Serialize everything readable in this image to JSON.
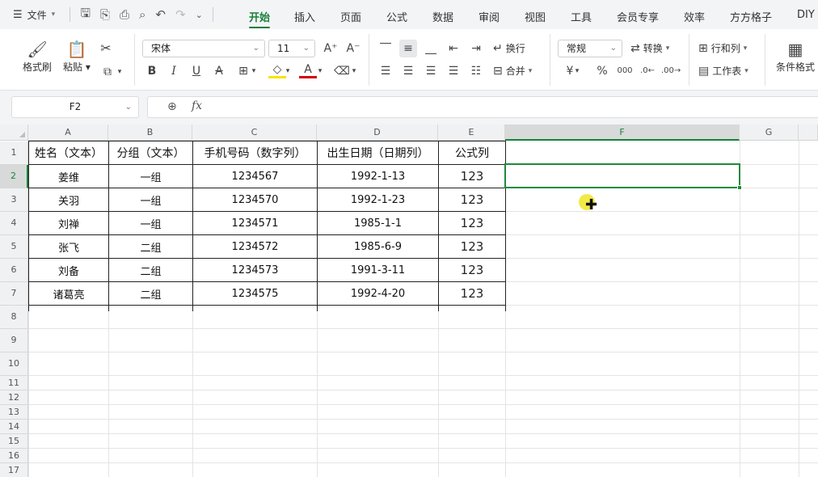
{
  "menubar": {
    "file_label": "文件",
    "tabs": [
      {
        "label": "开始",
        "active": true
      },
      {
        "label": "插入"
      },
      {
        "label": "页面"
      },
      {
        "label": "公式"
      },
      {
        "label": "数据"
      },
      {
        "label": "审阅"
      },
      {
        "label": "视图"
      },
      {
        "label": "工具"
      },
      {
        "label": "会员专享"
      },
      {
        "label": "效率"
      },
      {
        "label": "方方格子"
      },
      {
        "label": "DIY"
      }
    ]
  },
  "ribbon": {
    "format_painter": "格式刷",
    "paste": "粘贴",
    "font_name": "宋体",
    "font_size": "11",
    "wrap_text": "换行",
    "merge": "合并",
    "number_format": "常规",
    "convert": "转换",
    "rows_cols": "行和列",
    "worksheet": "工作表",
    "conditional_format": "条件格式",
    "bold": "B",
    "italic": "I",
    "underline": "U",
    "currency": "¥",
    "percent": "%"
  },
  "formula_bar": {
    "name_box": "F2",
    "fx": "fx",
    "value": ""
  },
  "sheet": {
    "columns": [
      "A",
      "B",
      "C",
      "D",
      "E",
      "F",
      "G"
    ],
    "selected_column": "F",
    "rows": [
      "1",
      "2",
      "3",
      "4",
      "5",
      "6",
      "7",
      "8",
      "9",
      "10",
      "11",
      "12",
      "13",
      "14",
      "15",
      "16",
      "17"
    ],
    "selected_row": "2",
    "header": [
      "姓名（文本）",
      "分组（文本）",
      "手机号码（数字列）",
      "出生日期（日期列）",
      "公式列"
    ],
    "data": [
      [
        "姜维",
        "一组",
        "1234567",
        "1992-1-13",
        "123"
      ],
      [
        "关羽",
        "一组",
        "1234570",
        "1992-1-23",
        "123"
      ],
      [
        "刘禅",
        "一组",
        "1234571",
        "1985-1-1",
        "123"
      ],
      [
        "张飞",
        "二组",
        "1234572",
        "1985-6-9",
        "123"
      ],
      [
        "刘备",
        "二组",
        "1234573",
        "1991-3-11",
        "123"
      ],
      [
        "诸葛亮",
        "二组",
        "1234575",
        "1992-4-20",
        "123"
      ]
    ]
  }
}
